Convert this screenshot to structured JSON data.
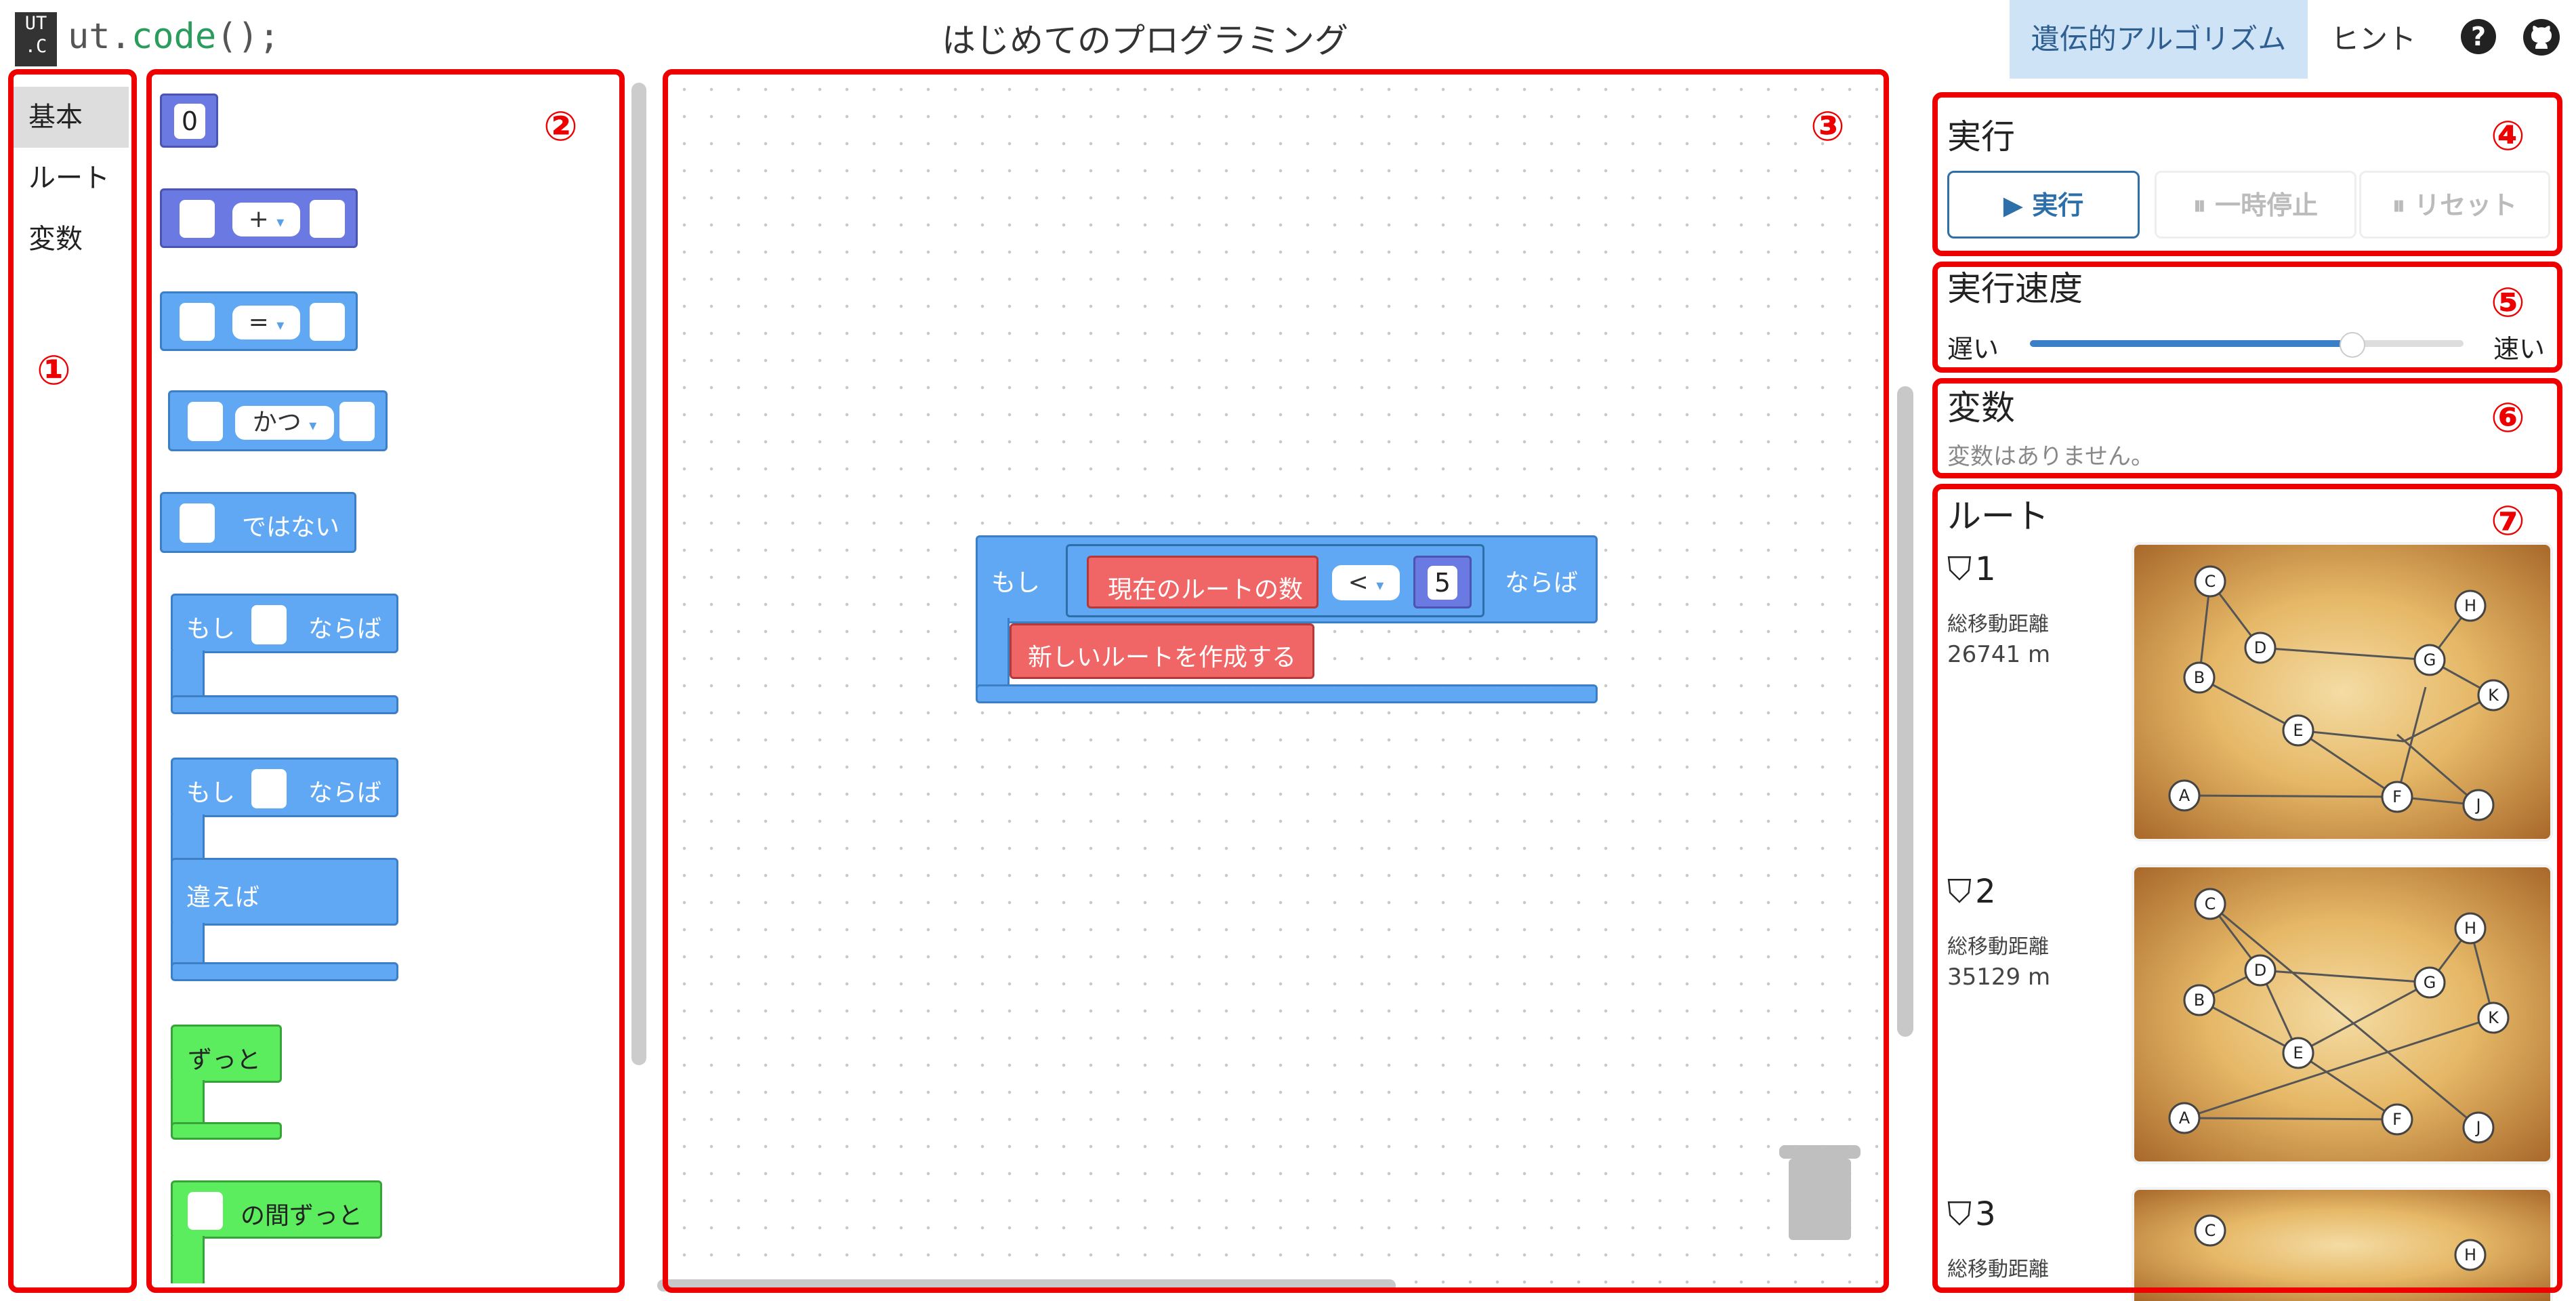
{
  "header": {
    "logo_badge_top": "UT",
    "logo_badge_bottom": ".C",
    "logo_prefix": "ut.",
    "logo_keyword": "code",
    "logo_suffix": "();",
    "page_title": "はじめてのプログラミング",
    "nav": {
      "genetic": "遺伝的アルゴリズム",
      "hint": "ヒント",
      "help": "?"
    }
  },
  "categories": [
    "基本",
    "ルート",
    "変数"
  ],
  "toolbox": {
    "number_value": "0",
    "plus_op": "+",
    "eq_op": "=",
    "and_op": "かつ",
    "not_label": "ではない",
    "if_label": "もし",
    "then_label": "ならば",
    "else_label": "違えば",
    "forever_label": "ずっと",
    "while_label": "の間ずっと"
  },
  "workspace": {
    "if_label": "もし",
    "route_count": "現在のルートの数",
    "compare_op": "<",
    "limit": "5",
    "then_label": "ならば",
    "create_route": "新しいルートを作成する"
  },
  "run_panel": {
    "title": "実行",
    "run": "実行",
    "pause": "一時停止",
    "reset": "リセット",
    "run_icon": "play-icon",
    "pause_icon": "pause-icon"
  },
  "speed_panel": {
    "title": "実行速度",
    "slow": "遅い",
    "fast": "速い",
    "level": 0.74
  },
  "variables_panel": {
    "title": "変数",
    "empty": "変数はありません。"
  },
  "routes_panel": {
    "title": "ルート",
    "distance_label": "総移動距離",
    "routes": [
      {
        "number": "1",
        "distance": "26741 m"
      },
      {
        "number": "2",
        "distance": "35129 m"
      },
      {
        "number": "3",
        "distance": ""
      }
    ],
    "nodes": [
      "A",
      "B",
      "C",
      "D",
      "E",
      "F",
      "G",
      "H",
      "J",
      "K"
    ]
  },
  "annotations": [
    "①",
    "②",
    "③",
    "④",
    "⑤",
    "⑥",
    "⑦"
  ],
  "colors": {
    "logic_block": "#60a8f4",
    "math_block": "#6b79e3",
    "loop_block": "#5ced5e",
    "route_block": "#f06565",
    "accent": "#2d6fa8",
    "annotation": "#e00000"
  }
}
